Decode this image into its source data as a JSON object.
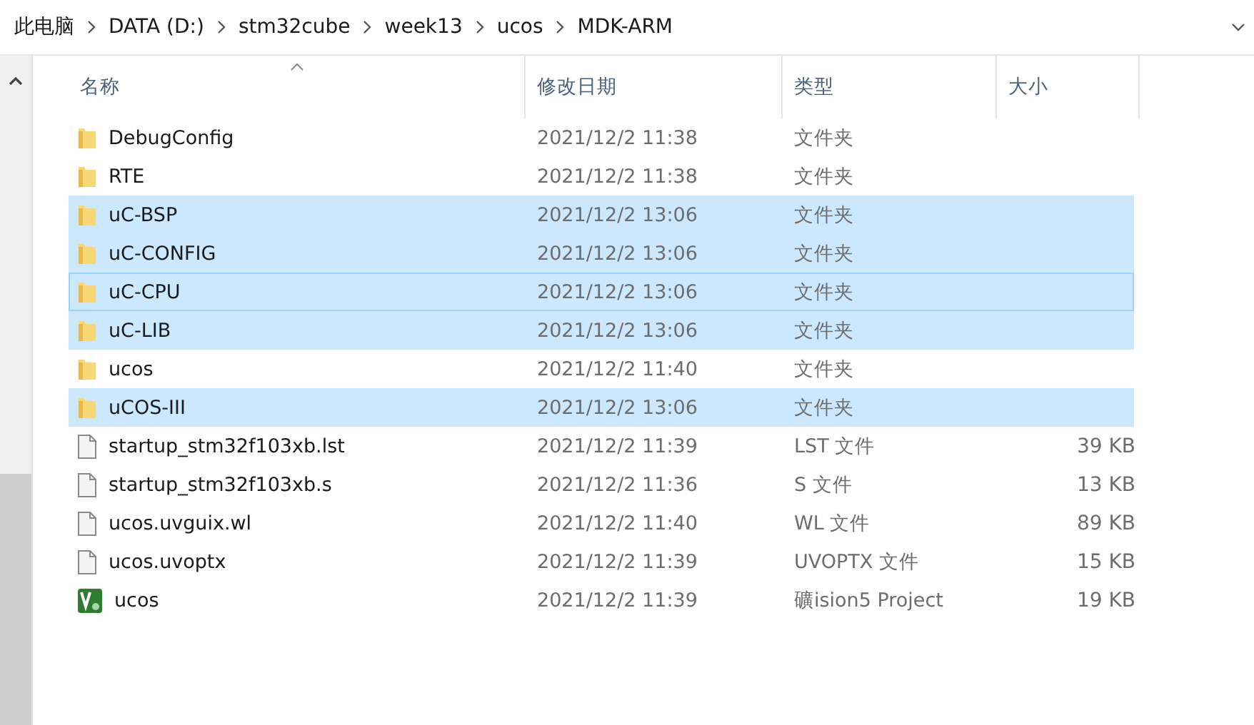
{
  "breadcrumb": [
    "此电脑",
    "DATA (D:)",
    "stm32cube",
    "week13",
    "ucos",
    "MDK-ARM"
  ],
  "columns": [
    {
      "label": "名称",
      "sorted": true
    },
    {
      "label": "修改日期",
      "sorted": false
    },
    {
      "label": "类型",
      "sorted": false
    },
    {
      "label": "大小",
      "sorted": false
    }
  ],
  "rows": [
    {
      "kind": "folder",
      "name": "DebugConfig",
      "date": "2021/12/2 11:38",
      "type": "文件夹",
      "selected": false,
      "focused": false
    },
    {
      "kind": "folder",
      "name": "RTE",
      "date": "2021/12/2 11:38",
      "type": "文件夹",
      "selected": false,
      "focused": false
    },
    {
      "kind": "folder",
      "name": "uC-BSP",
      "date": "2021/12/2 13:06",
      "type": "文件夹",
      "selected": true,
      "focused": false
    },
    {
      "kind": "folder",
      "name": "uC-CONFIG",
      "date": "2021/12/2 13:06",
      "type": "文件夹",
      "selected": true,
      "focused": false
    },
    {
      "kind": "folder",
      "name": "uC-CPU",
      "date": "2021/12/2 13:06",
      "type": "文件夹",
      "selected": true,
      "focused": true
    },
    {
      "kind": "folder",
      "name": "uC-LIB",
      "date": "2021/12/2 13:06",
      "type": "文件夹",
      "selected": true,
      "focused": false
    },
    {
      "kind": "folder",
      "name": "ucos",
      "date": "2021/12/2 11:40",
      "type": "文件夹",
      "selected": false,
      "focused": false
    },
    {
      "kind": "folder",
      "name": "uCOS-III",
      "date": "2021/12/2 13:06",
      "type": "文件夹",
      "selected": true,
      "focused": false
    },
    {
      "kind": "file",
      "name": "startup_stm32f103xb.lst",
      "date": "2021/12/2 11:39",
      "type": "LST 文件",
      "size": "39 KB",
      "selected": false,
      "focused": false
    },
    {
      "kind": "file",
      "name": "startup_stm32f103xb.s",
      "date": "2021/12/2 11:36",
      "type": "S 文件",
      "size": "13 KB",
      "selected": false,
      "focused": false
    },
    {
      "kind": "file",
      "name": "ucos.uvguix.wl",
      "date": "2021/12/2 11:40",
      "type": "WL 文件",
      "size": "89 KB",
      "selected": false,
      "focused": false
    },
    {
      "kind": "file",
      "name": "ucos.uvoptx",
      "date": "2021/12/2 11:39",
      "type": "UVOPTX 文件",
      "size": "15 KB",
      "selected": false,
      "focused": false
    },
    {
      "kind": "project",
      "name": "ucos",
      "date": "2021/12/2 11:39",
      "type": "礦ision5 Project",
      "size": "19 KB",
      "selected": false,
      "focused": false
    }
  ]
}
